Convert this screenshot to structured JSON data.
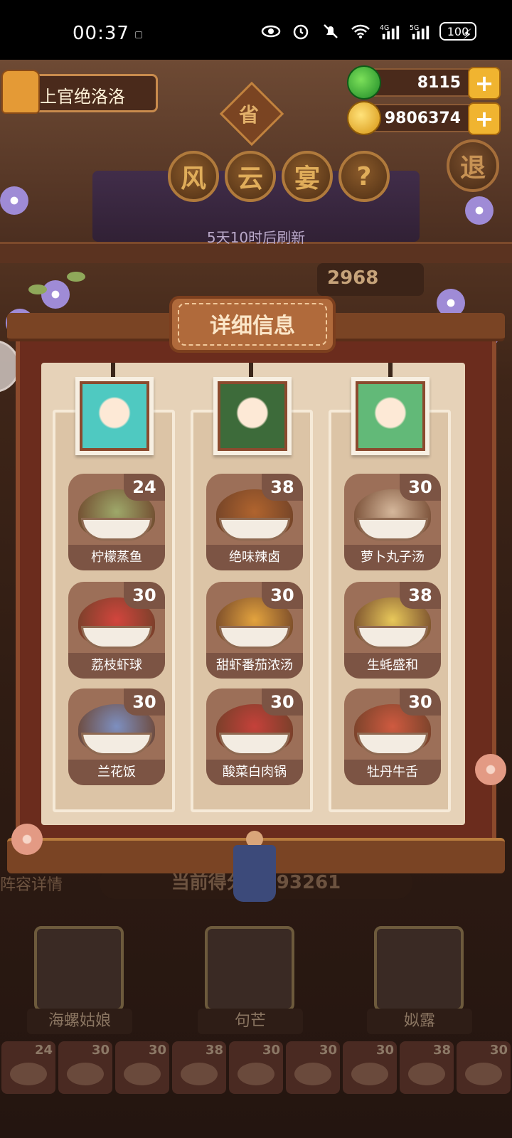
{
  "status_bar": {
    "time": "00:37",
    "battery": "100",
    "icons": [
      "eye-icon",
      "alarm-icon",
      "mute-icon",
      "wifi-icon",
      "signal-4g-icon",
      "signal-5g-icon"
    ]
  },
  "player": {
    "name": "上官绝洛洛"
  },
  "currency": {
    "jade": "8115",
    "gold": "9806374"
  },
  "top": {
    "sheng": "省",
    "title_chars": [
      "风",
      "云",
      "宴"
    ],
    "help": "?",
    "retreat": "退",
    "refresh_text": "5天10时后刷新",
    "score_partial": "2968"
  },
  "panel": {
    "title": "详细信息",
    "columns": [
      {
        "hero_color": "#4fc9c1",
        "dishes": [
          {
            "name": "柠檬蒸鱼",
            "count": "24",
            "color": "#9ea86a"
          },
          {
            "name": "荔枝虾球",
            "count": "30",
            "color": "#d2453d"
          },
          {
            "name": "兰花饭",
            "count": "30",
            "color": "#7d8fc0"
          }
        ]
      },
      {
        "hero_color": "#3d6b3a",
        "dishes": [
          {
            "name": "绝味辣卤",
            "count": "38",
            "color": "#b0642e"
          },
          {
            "name": "甜虾番茄浓汤",
            "count": "30",
            "color": "#e3a33e"
          },
          {
            "name": "酸菜白肉锅",
            "count": "30",
            "color": "#c5413a"
          }
        ]
      },
      {
        "hero_color": "#62b978",
        "dishes": [
          {
            "name": "萝卜丸子汤",
            "count": "30",
            "color": "#d5b79b"
          },
          {
            "name": "生蚝盛和",
            "count": "38",
            "color": "#e8c85a"
          },
          {
            "name": "牡丹牛舌",
            "count": "30",
            "color": "#cf5a40"
          }
        ]
      }
    ]
  },
  "bottom": {
    "lineup_label": "阵容详情",
    "score_text": "当前得分：293261",
    "heroes": [
      "海螺姑娘",
      "句芒",
      "姒露"
    ],
    "strip_counts": [
      "24",
      "30",
      "30",
      "38",
      "30",
      "30",
      "30",
      "38",
      "30"
    ]
  }
}
